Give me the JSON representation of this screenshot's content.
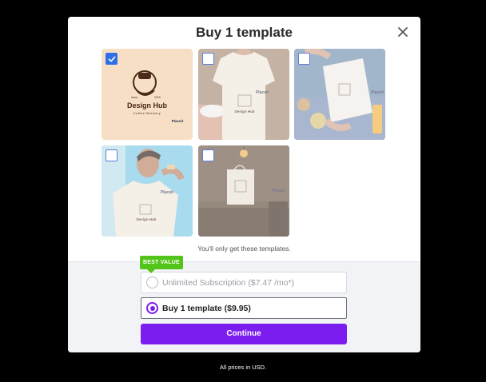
{
  "modal": {
    "title": "Buy 1 template",
    "note": "You'll only get these templates."
  },
  "templates": [
    {
      "name": "Design Hub Coffee Brewery logo",
      "selected": true
    },
    {
      "name": "T-shirt mockup",
      "selected": false
    },
    {
      "name": "Paper bag mockup",
      "selected": false
    },
    {
      "name": "Man in t-shirt mockup",
      "selected": false
    },
    {
      "name": "Tote bag mockup",
      "selected": false
    }
  ],
  "logo": {
    "line1": "Design Hub",
    "line2": "Coffee Brewery",
    "since": "since",
    "year": "2020"
  },
  "placeit": "Placeit",
  "badge": "BEST VALUE",
  "options": {
    "subscription": "Unlimited Subscription ($7.47 /mo*)",
    "single": "Buy 1 template ($9.95)"
  },
  "continue_label": "Continue",
  "footer_note": "All prices in USD.",
  "colors": {
    "accent": "#7c1df0",
    "check": "#2f6fe8",
    "badge": "#53c41a"
  }
}
